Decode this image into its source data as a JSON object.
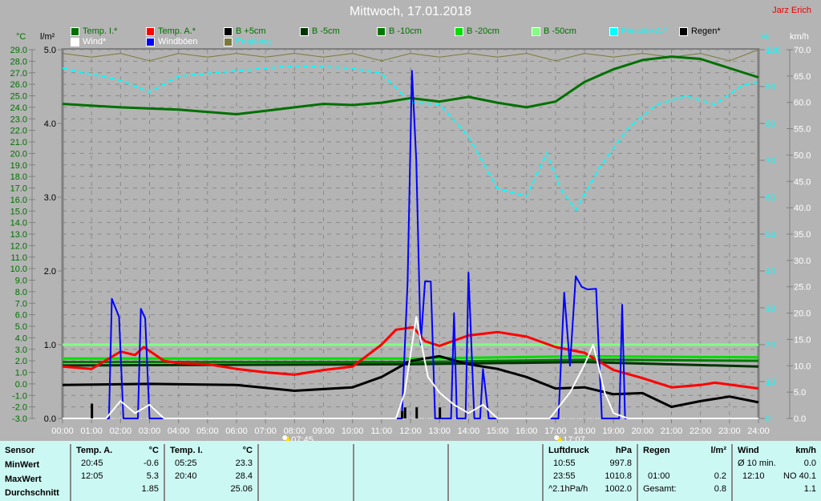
{
  "header": {
    "title": "Mittwoch, 17.01.2018",
    "author": "Jarz Erich"
  },
  "legend": [
    {
      "label": "Temp. I.*",
      "color": "#007000",
      "text_color": "#007000"
    },
    {
      "label": "Temp. A.*",
      "color": "#ff0000",
      "text_color": "#007000"
    },
    {
      "label": "B +5cm",
      "color": "#000000",
      "text_color": "#007000"
    },
    {
      "label": "B -5cm",
      "color": "#003300",
      "text_color": "#007000"
    },
    {
      "label": "B -10cm",
      "color": "#007700",
      "text_color": "#007000"
    },
    {
      "label": "B -20cm",
      "color": "#00dd00",
      "text_color": "#007000"
    },
    {
      "label": "B -50cm",
      "color": "#80ff80",
      "text_color": "#007000"
    },
    {
      "label": "Feuchte A.*",
      "color": "#00ffff",
      "text_color": "#00ffff"
    },
    {
      "label": "Regen*",
      "color": "#000000",
      "text_color": "#000000"
    },
    {
      "label": "Wind*",
      "color": "#ffffff",
      "text_color": "#ffffff"
    },
    {
      "label": "Windböen",
      "color": "#0000ff",
      "text_color": "#ffffff"
    },
    {
      "label": "Empfang",
      "color": "#7a7a3a",
      "text_color": "#00ffff"
    }
  ],
  "chart_data": {
    "type": "line",
    "title": "Mittwoch, 17.01.2018",
    "x_range": [
      0,
      24
    ],
    "x_ticks": [
      "00:00",
      "01:00",
      "02:00",
      "03:00",
      "04:00",
      "05:00",
      "06:00",
      "07:00",
      "08:00",
      "09:00",
      "10:00",
      "11:00",
      "12:00",
      "13:00",
      "14:00",
      "15:00",
      "16:00",
      "17:00",
      "18:00",
      "19:00",
      "20:00",
      "21:00",
      "22:00",
      "23:00",
      "24:00"
    ],
    "axes": {
      "temp": {
        "unit": "°C",
        "range": [
          -3,
          29
        ],
        "ticks": [
          "29.0",
          "28.0",
          "27.0",
          "26.0",
          "25.0",
          "24.0",
          "23.0",
          "22.0",
          "21.0",
          "20.0",
          "19.0",
          "18.0",
          "17.0",
          "16.0",
          "15.0",
          "14.0",
          "13.0",
          "12.0",
          "11.0",
          "10.0",
          "9.0",
          "8.0",
          "7.0",
          "6.0",
          "5.0",
          "4.0",
          "3.0",
          "2.0",
          "1.0",
          "0.0",
          "-1.0",
          "-2.0",
          "-3.0"
        ]
      },
      "rain": {
        "unit": "l/m²",
        "range": [
          0,
          5
        ],
        "ticks": [
          "5.0",
          "4.0",
          "3.0",
          "2.0",
          "1.0",
          "0.0"
        ]
      },
      "humidity": {
        "unit": "%",
        "range": [
          0,
          100
        ],
        "ticks": [
          "100",
          "90",
          "80",
          "70",
          "60",
          "50",
          "40",
          "30",
          "20",
          "10",
          "0"
        ]
      },
      "wind": {
        "unit": "km/h",
        "range": [
          0,
          70
        ],
        "ticks": [
          "70.0",
          "65.0",
          "60.0",
          "55.0",
          "50.0",
          "45.0",
          "40.0",
          "35.0",
          "30.0",
          "25.0",
          "20.0",
          "15.0",
          "10.0",
          "5.0",
          "0.0"
        ]
      }
    },
    "sunrise": "07:45",
    "sunset": "17:07",
    "sunrise_hour": 7.75,
    "sunset_hour": 17.12,
    "series": [
      {
        "name": "Temp. I.*",
        "axis": "temp",
        "color": "#007000",
        "x": [
          0,
          2,
          4,
          6,
          7,
          8,
          9,
          10,
          11,
          12,
          13,
          14,
          15,
          16,
          17,
          18,
          19,
          20,
          21,
          22,
          23,
          24
        ],
        "y": [
          24.3,
          24.0,
          23.8,
          23.4,
          23.7,
          24.0,
          24.3,
          24.2,
          24.4,
          24.8,
          24.5,
          24.9,
          24.4,
          24.0,
          24.5,
          26.2,
          27.3,
          28.1,
          28.4,
          28.2,
          27.4,
          26.6
        ]
      },
      {
        "name": "Temp. A.*",
        "axis": "temp",
        "color": "#ff0000",
        "x": [
          0,
          1,
          2,
          2.5,
          2.8,
          3.5,
          4,
          5,
          6,
          7,
          8,
          9,
          10,
          11,
          11.5,
          12.1,
          12.5,
          13,
          14,
          15,
          16,
          17,
          18,
          19,
          20,
          21,
          22,
          22.5,
          24
        ],
        "y": [
          1.5,
          1.3,
          2.8,
          2.5,
          3.2,
          2.0,
          1.8,
          1.7,
          1.3,
          1.0,
          0.8,
          1.2,
          1.5,
          3.4,
          4.7,
          4.9,
          3.7,
          3.3,
          4.2,
          4.5,
          4.1,
          3.2,
          2.7,
          1.2,
          0.5,
          -0.3,
          -0.1,
          0.1,
          -0.4
        ]
      },
      {
        "name": "B +5cm",
        "axis": "temp",
        "color": "#000000",
        "x": [
          0,
          3,
          6,
          8,
          10,
          11,
          12,
          13,
          14,
          15,
          16,
          17,
          18,
          19,
          20,
          21,
          22,
          23,
          24
        ],
        "y": [
          -0.1,
          0.0,
          -0.1,
          -0.6,
          -0.3,
          0.6,
          2.0,
          2.4,
          1.7,
          1.3,
          0.6,
          -0.4,
          -0.3,
          -0.9,
          -0.8,
          -2.0,
          -1.5,
          -1.1,
          -1.6
        ]
      },
      {
        "name": "B -5cm",
        "axis": "temp",
        "color": "#003300",
        "x": [
          0,
          12,
          18,
          24
        ],
        "y": [
          1.6,
          1.7,
          1.9,
          1.5
        ]
      },
      {
        "name": "B -10cm",
        "axis": "temp",
        "color": "#007700",
        "x": [
          0,
          12,
          18,
          24
        ],
        "y": [
          1.9,
          1.9,
          2.1,
          2.0
        ]
      },
      {
        "name": "B -20cm",
        "axis": "temp",
        "color": "#00dd00",
        "x": [
          0,
          12,
          18,
          24
        ],
        "y": [
          2.2,
          2.2,
          2.4,
          2.3
        ]
      },
      {
        "name": "B -50cm",
        "axis": "temp",
        "color": "#80ff80",
        "x": [
          0,
          24
        ],
        "y": [
          3.4,
          3.4
        ]
      },
      {
        "name": "Feuchte A.*",
        "axis": "humidity",
        "color": "#00ffff",
        "dashed": true,
        "x": [
          0,
          2,
          3,
          4,
          6,
          8,
          10,
          11,
          12,
          13,
          14,
          15,
          16,
          16.7,
          17.2,
          17.7,
          18.5,
          19.5,
          20.5,
          21.5,
          22.5,
          23.5,
          24
        ],
        "y": [
          95,
          91.7,
          88.5,
          92.8,
          94.3,
          95.6,
          95,
          93.5,
          85.7,
          85.2,
          76.5,
          62.4,
          60.2,
          72,
          62,
          56.5,
          67.8,
          78.7,
          85.2,
          87.4,
          85.2,
          90.6,
          91
        ]
      },
      {
        "name": "Empfang",
        "axis": "humidity",
        "color": "#7a7a3a",
        "x": [
          0,
          1,
          2,
          3,
          4,
          5,
          6,
          7,
          8,
          9,
          10,
          11,
          12,
          13,
          14,
          15,
          16,
          17,
          18,
          19,
          20,
          21,
          22,
          23,
          24
        ],
        "y": [
          99,
          98,
          99,
          97,
          99,
          98,
          99,
          98,
          99,
          98,
          99,
          97,
          99,
          98,
          99,
          98,
          99,
          97,
          99,
          98,
          99,
          98,
          99,
          97,
          100
        ]
      },
      {
        "name": "Windböen",
        "axis": "wind",
        "color": "#0000ff",
        "x": [
          0,
          1.6,
          1.7,
          1.95,
          2.1,
          2.2,
          2.6,
          2.7,
          2.85,
          3.0,
          11.5,
          11.7,
          11.9,
          12.05,
          12.2,
          12.35,
          12.5,
          12.7,
          12.85,
          13.0,
          13.4,
          13.5,
          13.6,
          13.9,
          14.0,
          14.2,
          14.4,
          14.5,
          14.7,
          17.1,
          17.3,
          17.5,
          17.7,
          17.9,
          18.1,
          18.4,
          18.6,
          19.2,
          19.3,
          19.4,
          24
        ],
        "y": [
          0,
          0,
          22.7,
          19.3,
          0,
          0,
          0,
          20.8,
          19,
          0,
          0,
          0,
          26,
          66,
          49,
          14,
          26,
          26,
          0,
          0,
          0,
          20,
          0,
          0,
          27.7,
          0,
          0,
          9.4,
          0,
          0,
          23.9,
          10,
          27,
          25,
          24.5,
          24.6,
          0,
          0,
          21.6,
          0,
          0
        ]
      },
      {
        "name": "Wind*",
        "axis": "wind",
        "color": "#ffffff",
        "x": [
          0,
          1.5,
          2.0,
          2.5,
          3.0,
          3.5,
          11.5,
          11.8,
          12.2,
          12.6,
          13.0,
          13.5,
          14,
          14.5,
          15,
          16.8,
          17.5,
          18,
          18.3,
          18.7,
          19,
          19.5,
          24
        ],
        "y": [
          0,
          0,
          3.3,
          1,
          2.6,
          0,
          0,
          4.9,
          19.3,
          7.9,
          4.9,
          2.6,
          1,
          2.6,
          0,
          0,
          4.9,
          10.2,
          14,
          4.9,
          1,
          0,
          0
        ]
      },
      {
        "name": "Regen*",
        "axis": "rain",
        "color": "#000000",
        "type": "bar",
        "x": [
          1.0,
          11.7,
          11.8,
          12.2,
          13.0
        ],
        "y": [
          0.2,
          0.1,
          0.15,
          0.15,
          0.15
        ]
      }
    ]
  },
  "stats": {
    "sensor": {
      "header": "Sensor",
      "rows": [
        "MinWert",
        "MaxWert",
        "Durchschnitt"
      ]
    },
    "temp_a": {
      "header": "Temp. A.",
      "unit": "°C",
      "rows": [
        [
          "20:45",
          "-0.6"
        ],
        [
          "12:05",
          "5.3"
        ],
        [
          "",
          "1.85"
        ]
      ]
    },
    "temp_i": {
      "header": "Temp. I.",
      "unit": "°C",
      "rows": [
        [
          "05:25",
          "23.3"
        ],
        [
          "20:40",
          "28.4"
        ],
        [
          "",
          "25.06"
        ]
      ]
    },
    "pressure": {
      "header": "Luftdruck",
      "unit": "hPa",
      "rows": [
        [
          "10:55",
          "997.8"
        ],
        [
          "23:55",
          "1010.8"
        ],
        [
          "^2.1hPa/h",
          "1002.0"
        ]
      ]
    },
    "rain": {
      "header": "Regen",
      "unit": "l/m²",
      "rows": [
        [
          "",
          ""
        ],
        [
          "01:00",
          "0.2"
        ],
        [
          "Gesamt:",
          "0.8"
        ]
      ]
    },
    "wind": {
      "header": "Wind",
      "unit": "km/h",
      "rows": [
        [
          "Ø 10 min.",
          "0.0"
        ],
        [
          "12:10",
          "NO 40.1"
        ],
        [
          "",
          "1.1"
        ]
      ]
    }
  }
}
